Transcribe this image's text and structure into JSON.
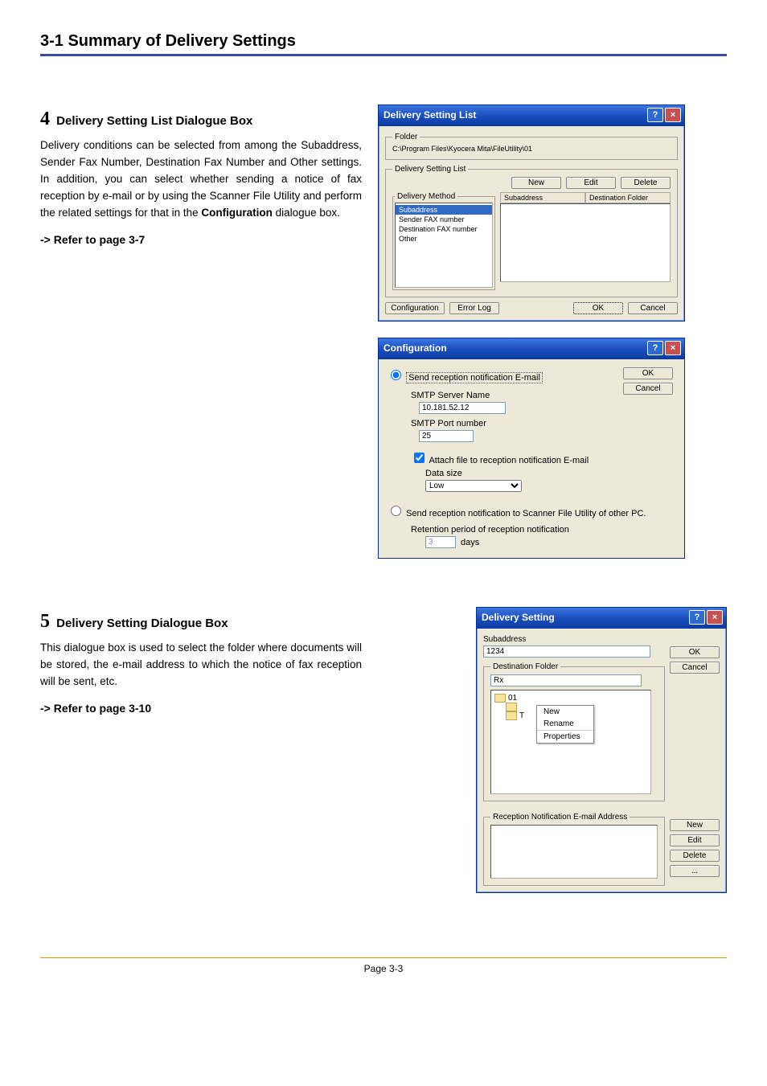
{
  "header": {
    "title": "3-1 Summary of Delivery Settings"
  },
  "section4": {
    "num": "4",
    "heading": "Delivery Setting List Dialogue Box",
    "para": "Delivery conditions can be selected from among the Subaddress, Sender Fax Number, Destination Fax Number and Other settings. In addition, you can select whether sending a notice of fax reception by e-mail or by using the Scanner File Utility and perform the related settings for that in the ",
    "bold_word": "Configuration",
    "para_tail": " dialogue box.",
    "ref": "-> Refer to page 3-7"
  },
  "dialog1": {
    "title": "Delivery Setting List",
    "folder_legend": "Folder",
    "folder_path": "C:\\Program Files\\Kyocera Mita\\FileUtility\\01",
    "list_legend": "Delivery Setting List",
    "btn_new": "New",
    "btn_edit": "Edit",
    "btn_delete": "Delete",
    "method_legend": "Delivery Method",
    "methods": [
      "Subaddress",
      "Sender FAX number",
      "Destination FAX number",
      "Other"
    ],
    "col_sub": "Subaddress",
    "col_dest": "Destination Folder",
    "btn_config": "Configuration",
    "btn_errlog": "Error Log",
    "btn_ok": "OK",
    "btn_cancel": "Cancel"
  },
  "dialog2": {
    "title": "Configuration",
    "opt1": "Send reception notification E-mail",
    "smtp_server_label": "SMTP Server Name",
    "smtp_server_value": "10.181.52.12",
    "smtp_port_label": "SMTP Port number",
    "smtp_port_value": "25",
    "attach_label": "Attach file to reception notification E-mail",
    "data_size_label": "Data size",
    "data_size_value": "Low",
    "opt2": "Send reception notification to Scanner File Utility of other PC.",
    "retention_label": "Retention period of reception notification",
    "retention_value": "3",
    "retention_unit": "days",
    "btn_ok": "OK",
    "btn_cancel": "Cancel"
  },
  "section5": {
    "num": "5",
    "heading": "Delivery Setting Dialogue Box",
    "para": "This dialogue box is used to select the folder where documents will be stored, the e-mail address to which the notice of fax reception will be sent, etc.",
    "ref": "-> Refer to page 3-10"
  },
  "dialog3": {
    "title": "Delivery Setting",
    "sub_label": "Subaddress",
    "sub_value": "1234",
    "dest_legend": "Destination Folder",
    "dest_value": "Rx",
    "tree_items": [
      "01",
      "T"
    ],
    "ctx": [
      "New",
      "Rename",
      "Properties"
    ],
    "email_label": "Reception Notification E-mail Address",
    "btn_ok": "OK",
    "btn_cancel": "Cancel",
    "btn_new": "New",
    "btn_edit": "Edit",
    "btn_delete": "Delete",
    "btn_more": "..."
  },
  "footer": {
    "page": "Page 3-3"
  }
}
